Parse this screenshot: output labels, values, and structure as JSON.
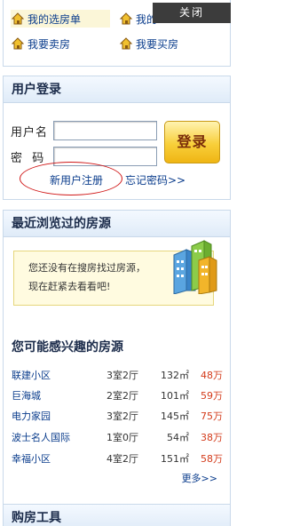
{
  "quick_links": [
    {
      "label": "我的选房单",
      "icon": "house-icon"
    },
    {
      "label": "我的",
      "icon": "house-icon"
    },
    {
      "label": "我要卖房",
      "icon": "house-icon"
    },
    {
      "label": "我要买房",
      "icon": "house-icon"
    }
  ],
  "close_label": "关闭",
  "login": {
    "title": "用户登录",
    "username_label": "用户名",
    "password_label": "密  码",
    "username_value": "",
    "password_value": "",
    "login_button": "登录",
    "register_link": "新用户注册",
    "forgot_link": "忘记密码>>"
  },
  "recent": {
    "title": "最近浏览过的房源",
    "notice_line1": "您还没有在搜房找过房源，",
    "notice_line2": "现在赶紧去看看吧!"
  },
  "interest": {
    "title": "您可能感兴趣的房源",
    "listings": [
      {
        "name": "联建小区",
        "layout": "3室2厅",
        "area": "132㎡",
        "price": "48万"
      },
      {
        "name": "巨海城",
        "layout": "2室2厅",
        "area": "101㎡",
        "price": "59万"
      },
      {
        "name": "电力家园",
        "layout": "3室2厅",
        "area": "145㎡",
        "price": "75万"
      },
      {
        "name": "波士名人国际",
        "layout": "1室0厅",
        "area": "54㎡",
        "price": "38万"
      },
      {
        "name": "幸福小区",
        "layout": "4室2厅",
        "area": "151㎡",
        "price": "58万"
      }
    ],
    "more_link": "更多>>"
  },
  "tools": {
    "title": "购房工具"
  },
  "colors": {
    "link": "#0a3c8c",
    "price": "#d33a1a",
    "button": "#f8cf3a",
    "panel_border": "#c9d9ea"
  }
}
